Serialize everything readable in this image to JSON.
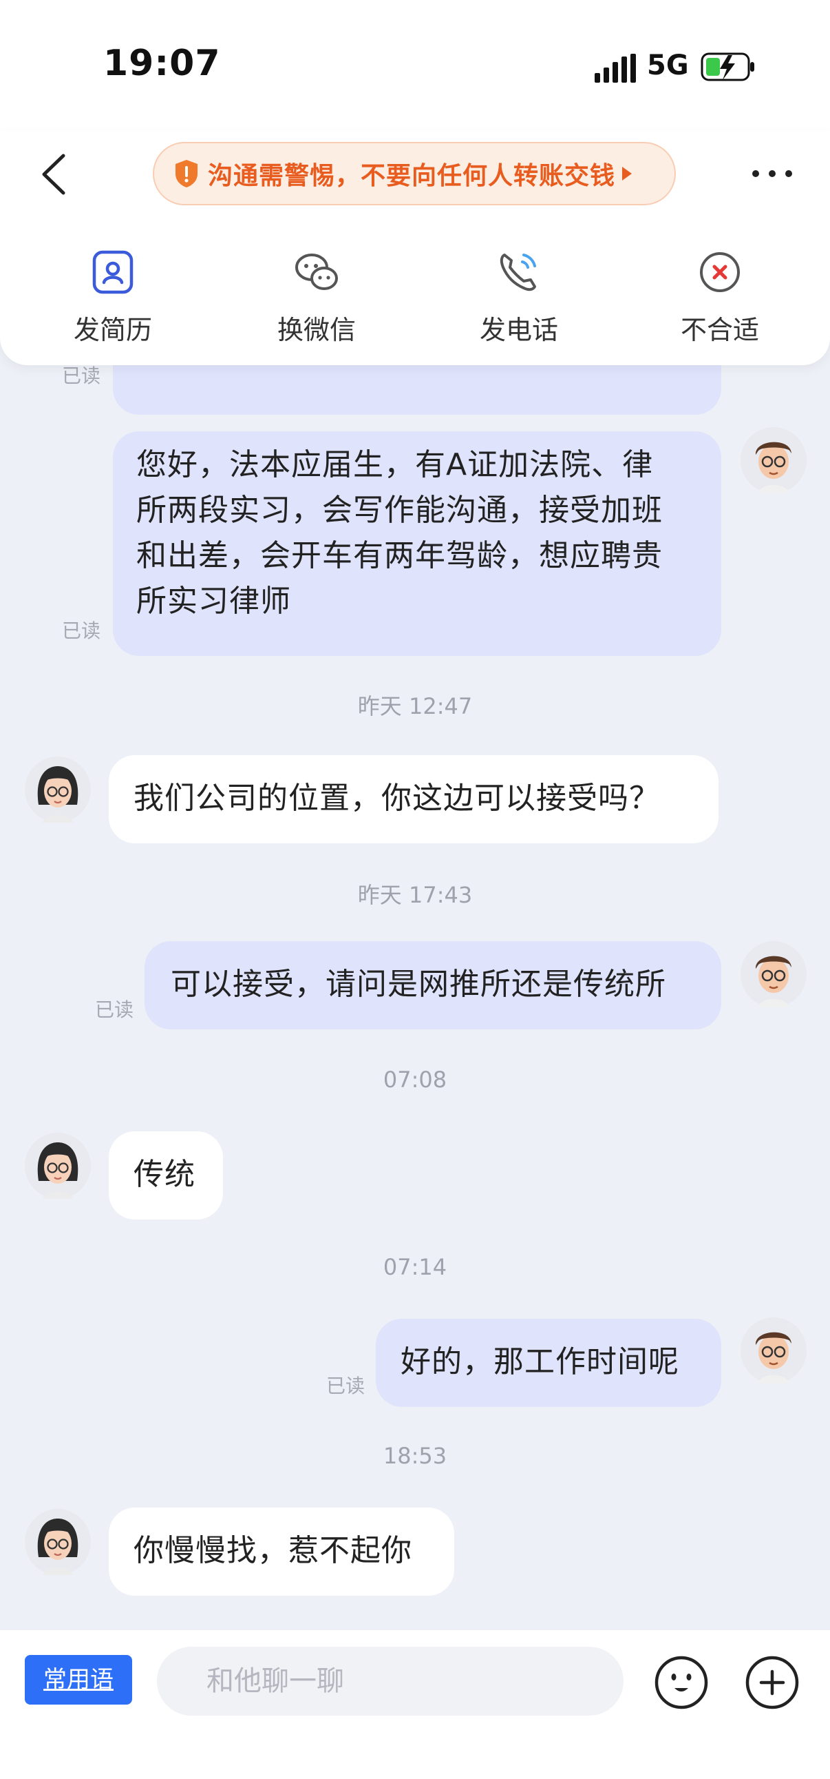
{
  "status": {
    "time": "19:07",
    "network": "5G"
  },
  "header": {
    "warning": "沟通需警惕，不要向任何人转账交钱",
    "actions": [
      {
        "label": "发简历",
        "icon": "resume-icon"
      },
      {
        "label": "换微信",
        "icon": "wechat-icon"
      },
      {
        "label": "发电话",
        "icon": "phone-icon"
      },
      {
        "label": "不合适",
        "icon": "reject-icon"
      }
    ]
  },
  "chat": {
    "read_label": "已读",
    "messages": [
      {
        "from": "me",
        "read": "已读",
        "lines": [
          "您好，法本应届生，有A证加法院、律",
          "所两段实习，会写作能沟通，接受加班",
          "和出差，会开车有两年驾龄，想应聘贵",
          "所实习律师"
        ]
      },
      {
        "stamp": "昨天 12:47"
      },
      {
        "from": "them",
        "text": "我们公司的位置，你这边可以接受吗？"
      },
      {
        "stamp": "昨天 17:43"
      },
      {
        "from": "me",
        "read": "已读",
        "text": "可以接受，请问是网推所还是传统所"
      },
      {
        "stamp": "07:08"
      },
      {
        "from": "them",
        "text": "传统"
      },
      {
        "stamp": "07:14"
      },
      {
        "from": "me",
        "read": "已读",
        "text": "好的，那工作时间呢"
      },
      {
        "stamp": "18:53"
      },
      {
        "from": "them",
        "text": "你慢慢找，惹不起你"
      }
    ]
  },
  "input": {
    "phrases_label": "常用语",
    "placeholder": "和他聊一聊"
  },
  "colors": {
    "accent": "#2d6ff6",
    "my_bubble": "#dfe3fb",
    "warning": "#e85d1f",
    "background": "#eef0f7"
  }
}
